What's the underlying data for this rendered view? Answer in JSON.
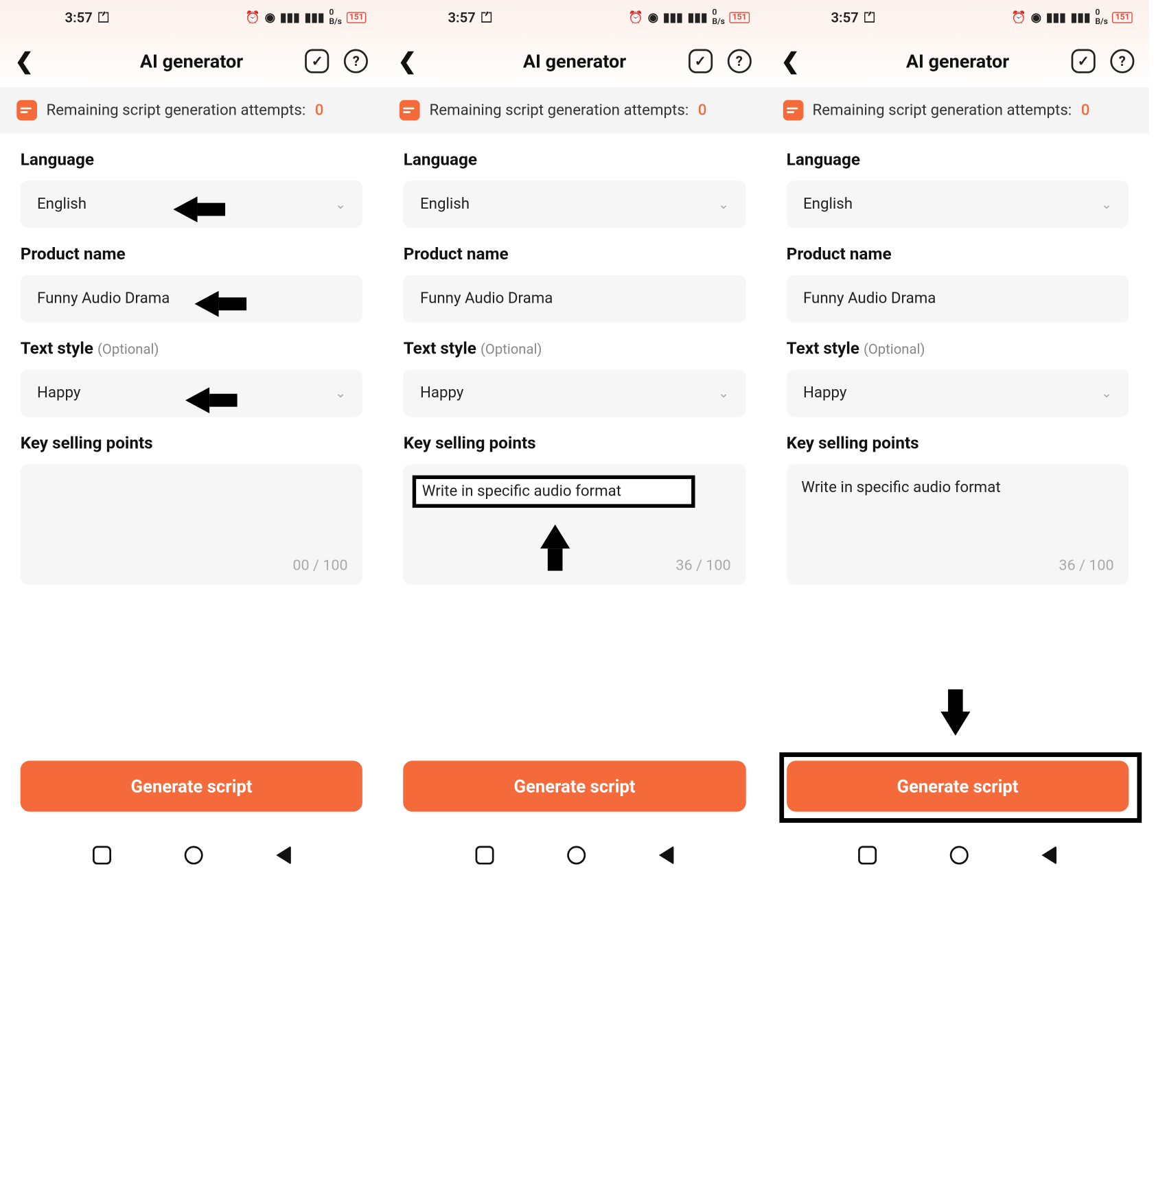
{
  "status": {
    "time": "3:57",
    "battery_label": "151"
  },
  "header": {
    "title": "AI generator"
  },
  "banner": {
    "text": "Remaining script generation attempts:",
    "count": "0"
  },
  "labels": {
    "language": "Language",
    "product": "Product name",
    "style": "Text style",
    "style_opt": "(Optional)",
    "ksp": "Key selling points"
  },
  "values": {
    "language": "English",
    "product": "Funny Audio Drama",
    "style": "Happy"
  },
  "ksp": {
    "text": "Write in specific audio format"
  },
  "counters": {
    "s1": "00 / 100",
    "s2": "36 / 100",
    "s3": "36 / 100"
  },
  "button": {
    "generate": "Generate script"
  }
}
